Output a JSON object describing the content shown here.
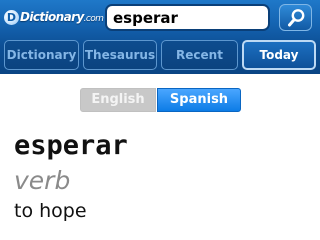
{
  "header": {
    "logo_mark": "D",
    "logo_text": "Dictionary",
    "logo_suffix": ".com"
  },
  "search": {
    "value": "esperar",
    "button_icon": "search-icon"
  },
  "tabs": [
    {
      "label": "Dictionary",
      "active": false
    },
    {
      "label": "Thesaurus",
      "active": false
    },
    {
      "label": "Recent",
      "active": false
    },
    {
      "label": "Today",
      "active": true
    }
  ],
  "languages": [
    {
      "label": "English",
      "selected": false
    },
    {
      "label": "Spanish",
      "selected": true
    }
  ],
  "entry": {
    "word": "esperar",
    "part_of_speech": "verb",
    "translation": "to hope"
  },
  "colors": {
    "header": "#1565b3",
    "active_language": "#1a88f0",
    "inactive_language": "#c8c8c8"
  }
}
